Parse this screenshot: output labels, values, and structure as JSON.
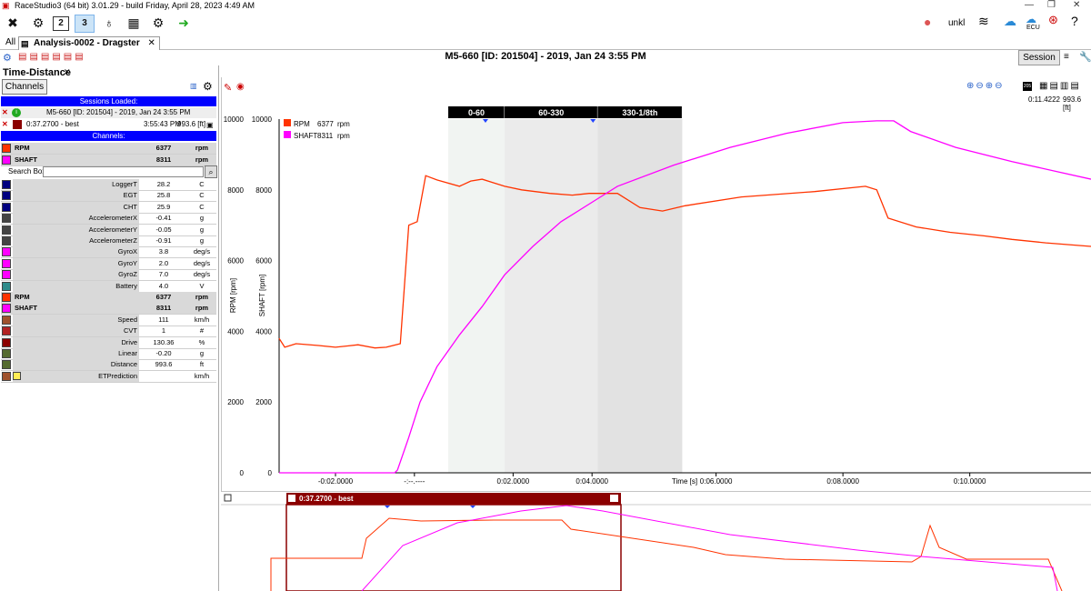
{
  "window": {
    "title": "RaceStudio3 (64 bit) 3.01.29 - build Friday, April 28, 2023 4:49 AM",
    "user": "unkl",
    "ecu_label": "ECU"
  },
  "tabs": {
    "all": "All",
    "analysis": "Analysis-0002 - Dragster"
  },
  "header": {
    "title": "M5-660 [ID: 201504] - 2019, Jan 24 3:55 PM",
    "session_button": "Session",
    "readout_time": "0:11.4222",
    "readout_dist": "993.6 [ft]"
  },
  "left": {
    "panel_title": "Time-Distance",
    "channels_button": "Channels",
    "sessions_loaded": "Sessions Loaded:",
    "session_row": "M5-660 [ID: 201504] - 2019, Jan 24 3:55 PM",
    "lap_label": "0:37.2700 - best",
    "lap_time": "3:55:43 PM",
    "lap_dist": "993.6 [ft]",
    "channels_header": "Channels:",
    "search_label": "Search Box",
    "pinned": [
      {
        "name": "RPM",
        "value": "6377",
        "unit": "rpm",
        "color": "#ff3300"
      },
      {
        "name": "SHAFT",
        "value": "8311",
        "unit": "rpm",
        "color": "#ff00ff"
      }
    ],
    "channels": [
      {
        "name": "LoggerT",
        "value": "28.2",
        "unit": "C",
        "color": "#000080",
        "bold": false
      },
      {
        "name": "EGT",
        "value": "25.8",
        "unit": "C",
        "color": "#000080",
        "bold": false
      },
      {
        "name": "CHT",
        "value": "25.9",
        "unit": "C",
        "color": "#000080",
        "bold": false
      },
      {
        "name": "AccelerometerX",
        "value": "-0.41",
        "unit": "g",
        "color": "#444444",
        "bold": false
      },
      {
        "name": "AccelerometerY",
        "value": "-0.05",
        "unit": "g",
        "color": "#444444",
        "bold": false
      },
      {
        "name": "AccelerometerZ",
        "value": "-0.91",
        "unit": "g",
        "color": "#444444",
        "bold": false
      },
      {
        "name": "GyroX",
        "value": "3.8",
        "unit": "deg/s",
        "color": "#ff00ff",
        "bold": false
      },
      {
        "name": "GyroY",
        "value": "2.0",
        "unit": "deg/s",
        "color": "#ff00ff",
        "bold": false
      },
      {
        "name": "GyroZ",
        "value": "7.0",
        "unit": "deg/s",
        "color": "#ff00ff",
        "bold": false
      },
      {
        "name": "Battery",
        "value": "4.0",
        "unit": "V",
        "color": "#2e8b8b",
        "bold": false
      },
      {
        "name": "RPM",
        "value": "6377",
        "unit": "rpm",
        "color": "#ff3300",
        "bold": true
      },
      {
        "name": "SHAFT",
        "value": "8311",
        "unit": "rpm",
        "color": "#ff00ff",
        "bold": true
      },
      {
        "name": "Speed",
        "value": "111",
        "unit": "km/h",
        "color": "#a0522d",
        "bold": false
      },
      {
        "name": "CVT",
        "value": "1",
        "unit": "#",
        "color": "#b22222",
        "bold": false
      },
      {
        "name": "Drive",
        "value": "130.36",
        "unit": "%",
        "color": "#8b0000",
        "bold": false
      },
      {
        "name": "Linear",
        "value": "-0.20",
        "unit": "g",
        "color": "#556b2f",
        "bold": false
      },
      {
        "name": "Distance",
        "value": "993.6",
        "unit": "ft",
        "color": "#556b2f",
        "bold": false
      },
      {
        "name": "ETPrediction",
        "value": "",
        "unit": "km/h",
        "color": "#a0522d",
        "bold": false
      }
    ]
  },
  "chart_data": {
    "type": "line",
    "xlabel": "Time [s]",
    "x_ticks": [
      "-0:02.0000",
      "-:--.----",
      "0:02.0000",
      "0:04.0000",
      "0:06.0000",
      "0:08.0000",
      "0:10.0000"
    ],
    "xlim": [
      -3.0,
      11.4
    ],
    "y_left_label": "RPM [rpm]",
    "y_right_label": "SHAFT [rpm]",
    "ylim": [
      0,
      10000
    ],
    "y_ticks": [
      "0",
      "2000",
      "4000",
      "6000",
      "8000",
      "10000"
    ],
    "segments": [
      {
        "label": "0-60",
        "start": 0.0,
        "end": 1.0
      },
      {
        "label": "60-330",
        "start": 1.0,
        "end": 2.65
      },
      {
        "label": "330-1/8th",
        "start": 2.65,
        "end": 4.15
      }
    ],
    "legend": [
      {
        "name": "RPM",
        "value": "6377",
        "unit": "rpm",
        "color": "#ff3300"
      },
      {
        "name": "SHAFT",
        "value": "8311",
        "unit": "rpm",
        "color": "#ff00ff"
      }
    ],
    "series": [
      {
        "name": "RPM",
        "color": "#ff3300",
        "x": [
          -3.0,
          -2.9,
          -2.7,
          -2.3,
          -2.0,
          -1.6,
          -1.3,
          -1.1,
          -0.85,
          -0.7,
          -0.55,
          -0.4,
          -0.2,
          0.2,
          0.4,
          0.6,
          0.8,
          1.0,
          1.3,
          1.8,
          2.2,
          2.5,
          3.0,
          3.4,
          3.8,
          4.2,
          5.2,
          6.5,
          7.4,
          7.6,
          7.8,
          8.3,
          8.9,
          9.5,
          10.0,
          10.6,
          11.4
        ],
        "y": [
          3800,
          3550,
          3650,
          3600,
          3550,
          3620,
          3530,
          3550,
          3650,
          7000,
          7100,
          8400,
          8280,
          8100,
          8250,
          8300,
          8200,
          8100,
          8000,
          7900,
          7850,
          7900,
          7900,
          7500,
          7400,
          7550,
          7800,
          7950,
          8100,
          8000,
          7200,
          6950,
          6800,
          6700,
          6600,
          6500,
          6400
        ]
      },
      {
        "name": "SHAFT",
        "color": "#ff00ff",
        "x": [
          -3.0,
          -1.5,
          -0.95,
          -0.9,
          -0.7,
          -0.5,
          -0.2,
          0.2,
          0.6,
          1.0,
          1.5,
          2.0,
          2.6,
          3.0,
          4.0,
          5.0,
          6.0,
          7.0,
          7.6,
          7.9,
          8.2,
          9.0,
          10.0,
          11.4
        ],
        "y": [
          0,
          0,
          0,
          80,
          1000,
          2000,
          3000,
          3900,
          4700,
          5600,
          6400,
          7100,
          7700,
          8100,
          8700,
          9200,
          9600,
          9900,
          9950,
          9950,
          9650,
          9200,
          8800,
          8300
        ]
      }
    ]
  },
  "overview": {
    "lap_label": "0:37.2700 - best"
  }
}
